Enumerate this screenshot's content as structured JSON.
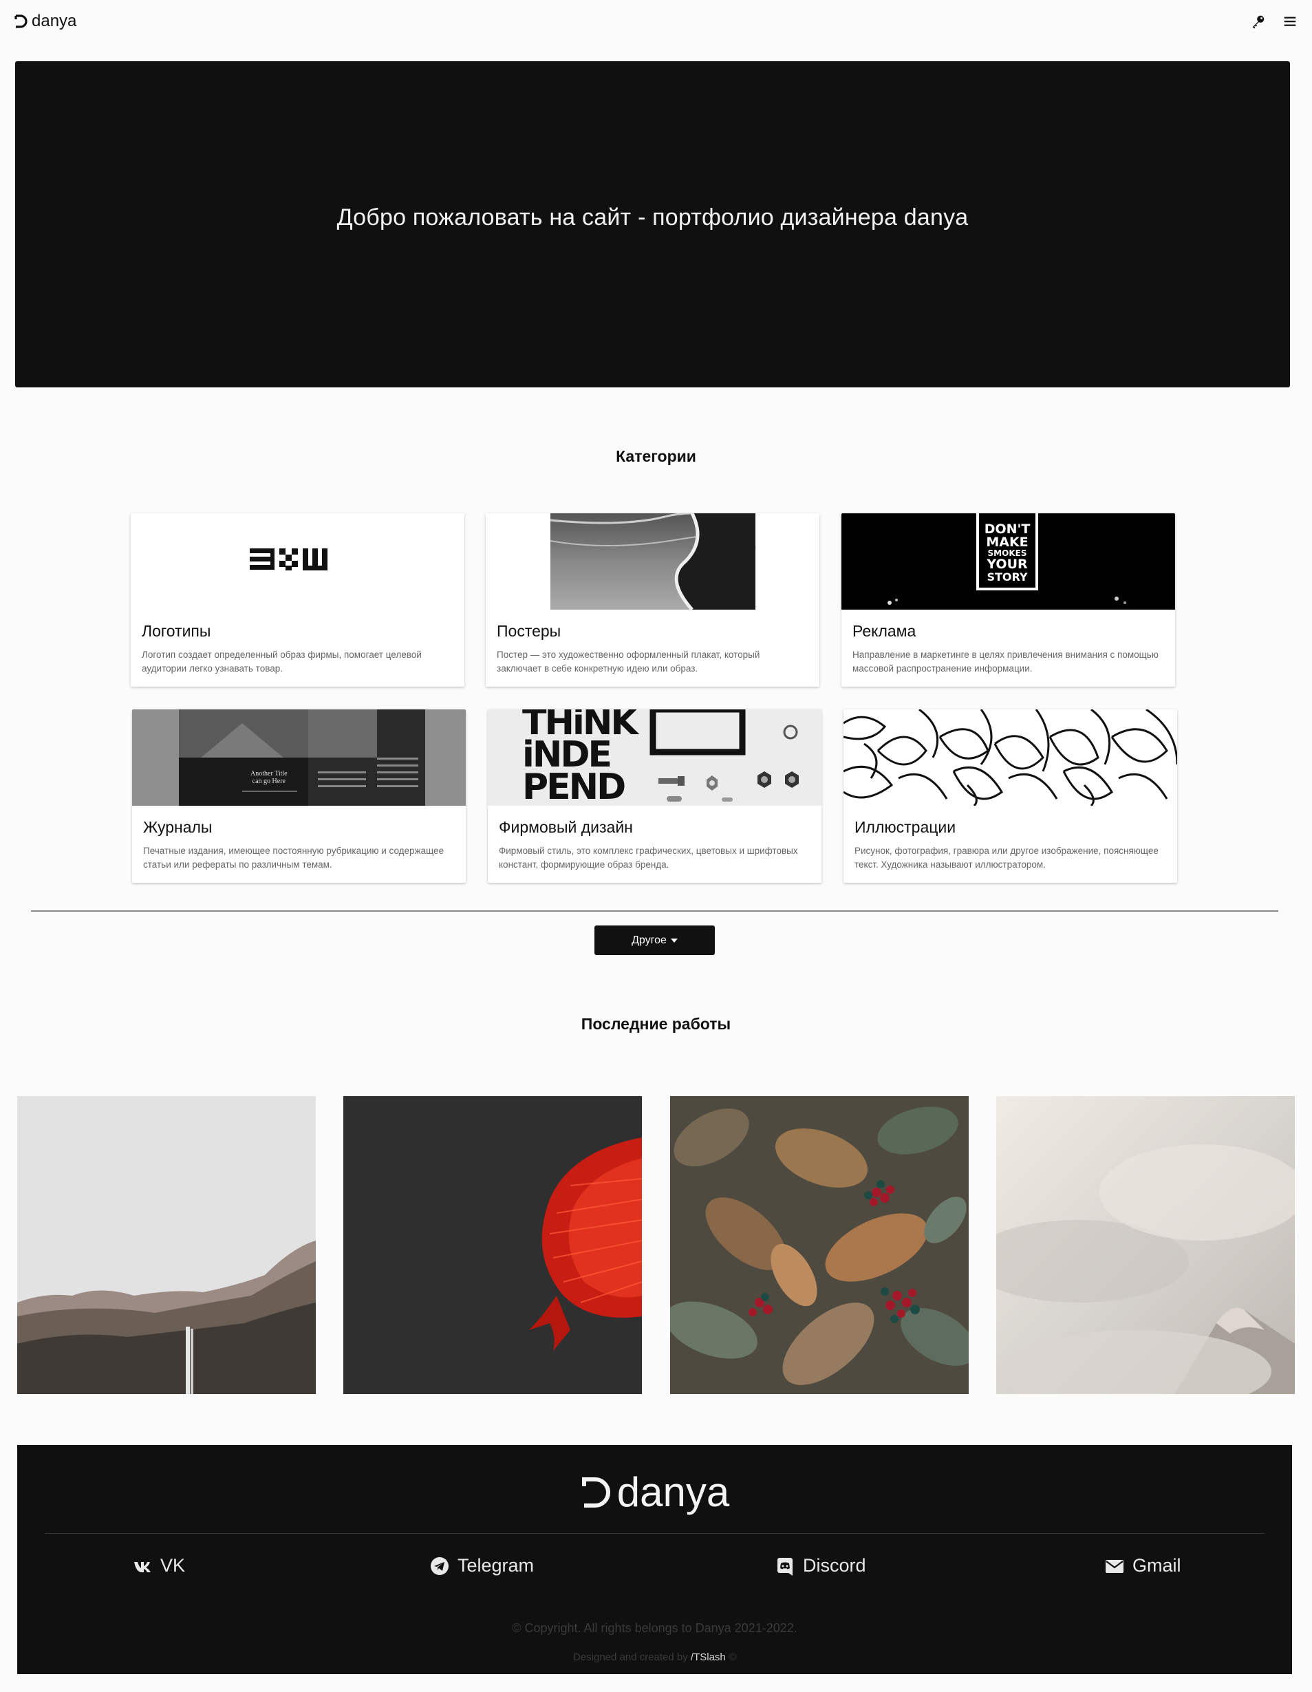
{
  "nav": {
    "brand": "danya",
    "icons": [
      "key-icon",
      "menu-icon"
    ]
  },
  "hero": {
    "title": "Добро пожаловать на сайт - портфолио дизайнера danya"
  },
  "categories": {
    "title": "Категории",
    "items": [
      {
        "title": "Логотипы",
        "desc": "Логотип создает определенный образ фирмы, помогает целевой аудитории легко узнавать товар.",
        "logo_text": "B&W"
      },
      {
        "title": "Постеры",
        "desc": "Постер — это художественно оформленный плакат, который заключает в себе конкретную идею или образ."
      },
      {
        "title": "Реклама",
        "desc": "Направление в маркетинге в целях привлечения внимания с помощью массовой распространение информации.",
        "poster_lines": [
          "DON'T",
          "MAKE",
          "SMOKES",
          "YOUR",
          "STORY"
        ]
      },
      {
        "title": "Журналы",
        "desc": "Печатные издания, имеющее постоянную рубрикацию и содержащее статьи или рефераты по различным темам.",
        "page_caption": [
          "Another Title",
          "can go Here"
        ]
      },
      {
        "title": "Фирмовый дизайн",
        "desc": "Фирмовый стиль, это комплекс графических, цветовых и шрифтовых констант, формирующие образ бренда.",
        "poster_lines": [
          "THiNK",
          "iNDE",
          "PEND"
        ]
      },
      {
        "title": "Иллюстрации",
        "desc": "Рисунок, фотография, гравюра или другое изображение, поясняющее текст. Художника называют иллюстратором."
      }
    ],
    "other_button": "Другое"
  },
  "works": {
    "title": "Последние работы"
  },
  "footer": {
    "brand": "danya",
    "socials": [
      {
        "label": "VK",
        "icon": "vk-icon"
      },
      {
        "label": "Telegram",
        "icon": "telegram-icon"
      },
      {
        "label": "Discord",
        "icon": "discord-icon"
      },
      {
        "label": "Gmail",
        "icon": "envelope-icon"
      }
    ],
    "copyright": "© Copyright. All rights belongs to Danya 2021-2022.",
    "credits_prefix": "Designed and created by",
    "credits_author": "/TSlash",
    "credits_suffix": "©"
  }
}
